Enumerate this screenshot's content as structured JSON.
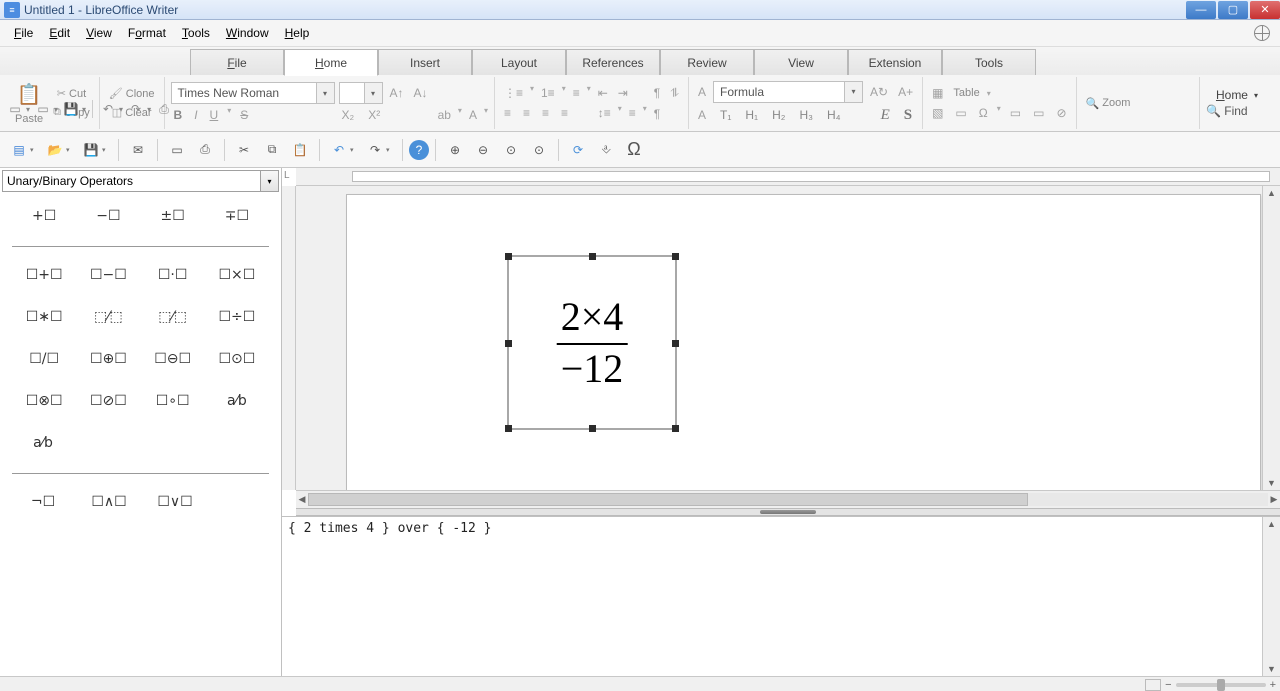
{
  "window": {
    "title": "Untitled 1 - LibreOffice Writer"
  },
  "menubar": [
    "File",
    "Edit",
    "View",
    "Format",
    "Tools",
    "Window",
    "Help"
  ],
  "ribbon_tabs": [
    "File",
    "Home",
    "Insert",
    "Layout",
    "References",
    "Review",
    "View",
    "Extension",
    "Tools"
  ],
  "active_tab": "Home",
  "ribbon": {
    "paste": "Paste",
    "cut": "Cut",
    "copy": "Copy",
    "clone": "Clone",
    "clear": "Clear",
    "font_name": "Times New Roman",
    "style_name": "Formula",
    "table_label": "Table",
    "zoom_label": "Zoom",
    "home_drop": "Home",
    "find_label": "Find"
  },
  "left_panel": {
    "category": "Unary/Binary Operators",
    "row1": [
      "+☐",
      "−☐",
      "±☐",
      "∓☐"
    ],
    "row2": [
      "☐+☐",
      "☐−☐",
      "☐·☐",
      "☐×☐"
    ],
    "row3": [
      "☐∗☐",
      "⬚⁄⬚",
      "⬚⁄⬚",
      "☐÷☐"
    ],
    "row4": [
      "☐/☐",
      "☐⊕☐",
      "☐⊖☐",
      "☐⊙☐"
    ],
    "row5": [
      "☐⊗☐",
      "☐⊘☐",
      "☐∘☐",
      "a⁄b"
    ],
    "row6": [
      "a⁄b",
      "",
      "",
      ""
    ],
    "row7": [
      "¬☐",
      "☐∧☐",
      "☐∨☐",
      ""
    ]
  },
  "formula": {
    "numerator": "2×4",
    "denominator": "−12"
  },
  "command_text": "{ 2 times 4 } over { -12 }",
  "icons": {
    "scissors": "✂",
    "copy": "⧉",
    "brush": "🖌",
    "eraser": "◫",
    "bold": "B",
    "italic": "I",
    "underline": "U",
    "strike": "S",
    "sub": "X₂",
    "sup": "X²",
    "aleft": "≡",
    "acenter": "≡",
    "aright": "≡",
    "ajust": "≡",
    "indentdec": "⇤",
    "indentinc": "⇥",
    "para": "¶",
    "char": "A",
    "t1": "T₁",
    "h1": "H₁",
    "h2": "H₂",
    "h3": "H₃",
    "h4": "H₄",
    "emi": "E",
    "ems": "S",
    "img": "▧",
    "chart": "◫",
    "eq": "Ω",
    "emoji": "☺",
    "link": "⊘",
    "note": "▭",
    "new": "▭",
    "open": "📂",
    "save": "💾",
    "mail": "✉",
    "export": "▭",
    "print": "⎙",
    "cut2": "✂",
    "copy2": "⧉",
    "paste2": "📋",
    "undo": "↶",
    "redo": "↷",
    "help": "?",
    "zoomp": "⊕",
    "zoomm": "⊖",
    "zoom100": "⊙",
    "zoompage": "▭",
    "refresh": "⟳",
    "cursor": "⎀",
    "omega": "Ω",
    "grid": "▦",
    "dropdown": "▾"
  },
  "heading_icons": [
    "T₁",
    "H₁",
    "H₂",
    "H₃",
    "H₄"
  ]
}
